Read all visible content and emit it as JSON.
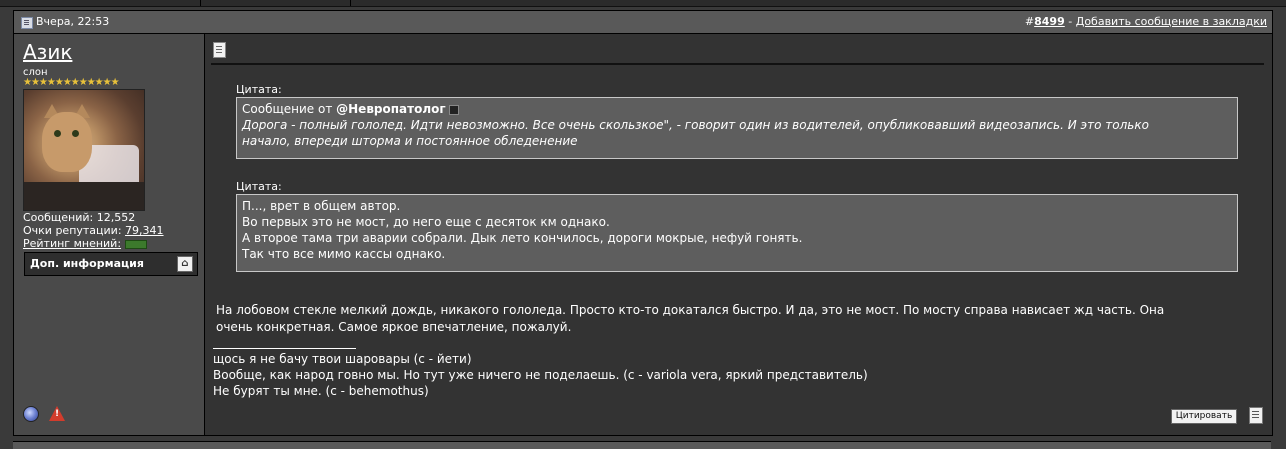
{
  "post": {
    "date": "Вчера, 22:53",
    "number_prefix": "#",
    "number": "8499",
    "separator": " - ",
    "bookmark_link": "Добавить сообщение в закладки"
  },
  "user": {
    "name": "Азик",
    "title": "слон",
    "stars": "★★★★★★★★★★★★",
    "posts_label": "Сообщений:",
    "posts": "12,552",
    "rep_points_label": "Очки репутации:",
    "rep_points": "79,341",
    "rating_label": "Рейтинг мнений:",
    "more_info_label": "Доп. информация"
  },
  "quotes": [
    {
      "label": "Цитата:",
      "from_prefix": "Сообщение от ",
      "author": "@Невропатолог",
      "lines": [
        "Дорога - полный гололед. Идти невозможно. Все очень скользкое\", - говорит один из водителей, опубликовавший видеозапись. И это только",
        "начало, впереди шторма и постоянное обледенение"
      ]
    },
    {
      "label": "Цитата:",
      "lines": [
        "П..., врет в общем автор.",
        "Во первых это не мост, до него еще с десяток км однако.",
        "А второе тама три аварии собрали. Дык лето кончилось, дороги мокрые, нефуй гонять.",
        "Так что все мимо кассы однако."
      ]
    }
  ],
  "body": [
    "На лобовом стекле мелкий дождь, никакого гололеда. Просто кто-то докатался быстро. И да, это не мост. По мосту справа нависает жд часть. Она",
    "очень конкретная. Самое яркое впечатление, пожалуй."
  ],
  "signature": [
    "щось я не бачу твои шаровары (с - йети)",
    "Вообще, как народ говно мы. Но тут уже ничего не поделаешь. (с - variola vera, яркий представитель)",
    "Не бурят ты мне. (с - behemothus)"
  ],
  "buttons": {
    "quote": "Цитировать"
  },
  "icons": {
    "post_icon": "document-icon",
    "status": "offline-status-icon",
    "report": "report-icon",
    "collapse": "collapse-icon",
    "multiquote": "multiquote-icon"
  },
  "colors": {
    "background": "#3a3a3a",
    "header": "#595959",
    "sidebar": "#4a4a4a",
    "content": "#333333",
    "quote_box": "#5e5e5e",
    "stars": "#e8c13a"
  }
}
